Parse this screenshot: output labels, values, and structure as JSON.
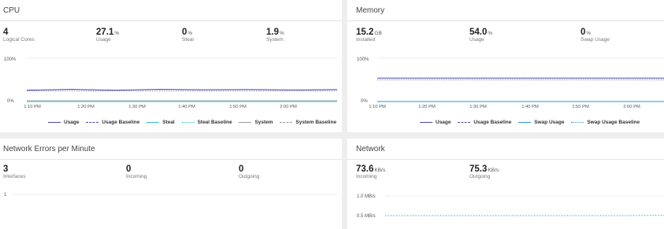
{
  "colors": {
    "usage": "#4a4aa8",
    "steal": "#33b9c8",
    "system": "#9a9a9a",
    "swap": "#2f8fe0",
    "grid": "#e6e6e6"
  },
  "cpu": {
    "title": "CPU",
    "metrics": [
      {
        "value": "4",
        "unit": "",
        "label": "Logical Cores"
      },
      {
        "value": "27.1",
        "unit": "%",
        "label": "Usage"
      },
      {
        "value": "0",
        "unit": "%",
        "label": "Steal"
      },
      {
        "value": "1.9",
        "unit": "%",
        "label": "System"
      }
    ],
    "y_top": "100%",
    "y_bottom": "0%",
    "x_ticks": [
      "1:10 PM",
      "1:20 PM",
      "1:30 PM",
      "1:40 PM",
      "1:50 PM",
      "2:00 PM"
    ],
    "legend": [
      "Usage",
      "Usage Baseline",
      "Steal",
      "Steal Baseline",
      "System",
      "System Baseline"
    ]
  },
  "memory": {
    "title": "Memory",
    "metrics": [
      {
        "value": "15.2",
        "unit": "GB",
        "label": "Installed"
      },
      {
        "value": "54.0",
        "unit": "%",
        "label": "Usage"
      },
      {
        "value": "0",
        "unit": "%",
        "label": "Swap Usage"
      }
    ],
    "y_top": "100%",
    "y_bottom": "0%",
    "x_ticks": [
      "1:10 PM",
      "1:20 PM",
      "1:30 PM",
      "1:40 PM",
      "1:50 PM",
      "2:00 PM"
    ],
    "legend": [
      "Usage",
      "Usage Baseline",
      "Swap Usage",
      "Swap Usage Baseline"
    ]
  },
  "network_errors": {
    "title": "Network Errors per Minute",
    "metrics": [
      {
        "value": "3",
        "unit": "",
        "label": "Interfaces"
      },
      {
        "value": "0",
        "unit": "",
        "label": "Incoming"
      },
      {
        "value": "0",
        "unit": "",
        "label": "Outgoing"
      }
    ],
    "y_top": "1"
  },
  "network": {
    "title": "Network",
    "metrics": [
      {
        "value": "73.6",
        "unit": "KB/s",
        "label": "Incoming"
      },
      {
        "value": "75.3",
        "unit": "KB/s",
        "label": "Outgoing"
      }
    ],
    "y_top": "1.0 MB/s",
    "y_mid": "0.5 MB/s"
  },
  "chart_data": [
    {
      "type": "line",
      "title": "CPU",
      "x": [
        "1:10 PM",
        "1:20 PM",
        "1:30 PM",
        "1:40 PM",
        "1:50 PM",
        "2:00 PM"
      ],
      "ylim": [
        0,
        100
      ],
      "series": [
        {
          "name": "Usage",
          "values": [
            27,
            27.5,
            27,
            27.5,
            28,
            27,
            27.5,
            27
          ]
        },
        {
          "name": "Usage Baseline",
          "values": [
            27,
            27,
            27,
            27,
            27,
            27,
            27,
            27
          ]
        },
        {
          "name": "Steal",
          "values": [
            0,
            0,
            0,
            0,
            0,
            0,
            0,
            0
          ]
        },
        {
          "name": "Steal Baseline",
          "values": [
            0,
            0,
            0,
            0,
            0,
            0,
            0,
            0
          ]
        },
        {
          "name": "System",
          "values": [
            2,
            2,
            2,
            2,
            2,
            2,
            2,
            2
          ]
        },
        {
          "name": "System Baseline",
          "values": [
            2,
            2,
            2,
            2,
            2,
            2,
            2,
            2
          ]
        }
      ]
    },
    {
      "type": "line",
      "title": "Memory",
      "x": [
        "1:10 PM",
        "1:20 PM",
        "1:30 PM",
        "1:40 PM",
        "1:50 PM",
        "2:00 PM"
      ],
      "ylim": [
        0,
        100
      ],
      "series": [
        {
          "name": "Usage",
          "values": [
            54,
            54,
            54,
            54,
            54,
            54,
            54,
            54
          ]
        },
        {
          "name": "Usage Baseline",
          "values": [
            53,
            53,
            53,
            53,
            53,
            53,
            53,
            53
          ]
        },
        {
          "name": "Swap Usage",
          "values": [
            0,
            0,
            0,
            0,
            0,
            0,
            0,
            0
          ]
        },
        {
          "name": "Swap Usage Baseline",
          "values": [
            0,
            0,
            0,
            0,
            0,
            0,
            0,
            0
          ]
        }
      ]
    },
    {
      "type": "line",
      "title": "Network",
      "ylim": [
        0.5,
        1.0
      ],
      "series": [
        {
          "name": "Incoming",
          "values": [
            0.5,
            0.5,
            0.5,
            0.5,
            0.5,
            0.5,
            0.5,
            0.51
          ]
        }
      ]
    }
  ]
}
